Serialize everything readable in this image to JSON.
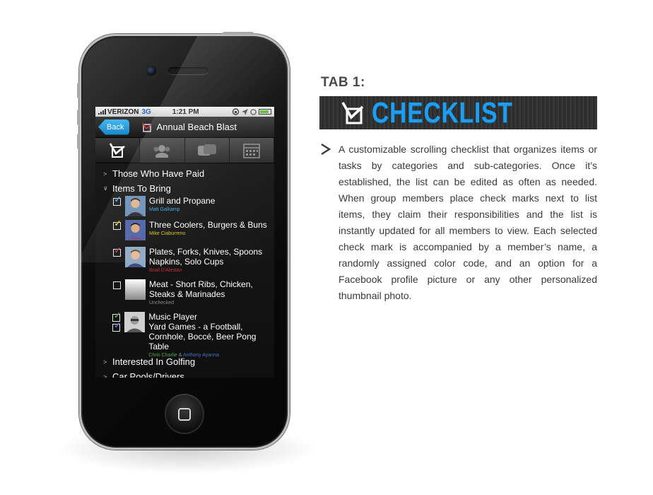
{
  "phone": {
    "statusbar": {
      "carrier": "VERIZON",
      "network": "3G",
      "time": "1:21 PM"
    },
    "navbar": {
      "back_label": "Back",
      "title": "Annual Beach Blast"
    },
    "tabs": [
      {
        "icon": "checklist-icon",
        "active": true
      },
      {
        "icon": "group-icon",
        "active": false
      },
      {
        "icon": "messages-icon",
        "active": false
      },
      {
        "icon": "calendar-icon",
        "active": false
      }
    ],
    "list": {
      "sections": [
        {
          "label": "Those Who Have Paid",
          "expanded": false
        },
        {
          "label": "Items To Bring",
          "expanded": true
        },
        {
          "label": "Interested In Golfing",
          "expanded": false
        },
        {
          "label": "Car Pools/Drivers",
          "expanded": false
        }
      ],
      "items": [
        {
          "title_lines": [
            "Grill and Propane"
          ],
          "members": [
            {
              "name": "Matt Galkamp",
              "color": "#3aa6e6"
            }
          ],
          "check_colors": [
            "#3aa6e6"
          ]
        },
        {
          "title_lines": [
            "Three Coolers, Burgers & Buns"
          ],
          "members": [
            {
              "name": "Mike Ciaburreno",
              "color": "#d8c21a"
            }
          ],
          "check_colors": [
            "#d8c21a"
          ]
        },
        {
          "title_lines": [
            "Plates, Forks, Knives, Spoons",
            "Napkins, Solo Cups"
          ],
          "members": [
            {
              "name": "Brad D'Alestan",
              "color": "#c0333a"
            }
          ],
          "check_colors": [
            "#c0333a"
          ]
        },
        {
          "title_lines": [
            "Meat - Short Ribs, Chicken,",
            "Steaks & Marinades"
          ],
          "status": "Unchecked",
          "status_color": "#8a8a8a",
          "check_colors": []
        },
        {
          "title_lines": [
            "Music Player",
            "Yard Games - a Football,",
            "Cornhole, Boccé, Beer Pong Table"
          ],
          "members": [
            {
              "name": "Chris Charlie",
              "color": "#49a64a"
            },
            {
              "name": "Anthony Ayanna",
              "color": "#4f6fc8"
            }
          ],
          "joiner": "&",
          "check_colors": [
            "#49a64a",
            "#4f6fc8"
          ]
        }
      ]
    }
  },
  "panel": {
    "heading": "TAB 1:",
    "banner_title": "CHECKLIST",
    "accent_color": "#1e9ef1",
    "description": "A customizable scrolling checklist that organizes items or tasks by categories and sub-categories. Once it’s established, the list can be edited as often as needed. When group members place check marks next to list items, they claim their responsibilities and the list is instantly updated for all members to view. Each selected check mark is accompanied by a member’s name, a randomly assigned color code, and an option for a Facebook profile picture or any other personalized thumbnail photo."
  }
}
